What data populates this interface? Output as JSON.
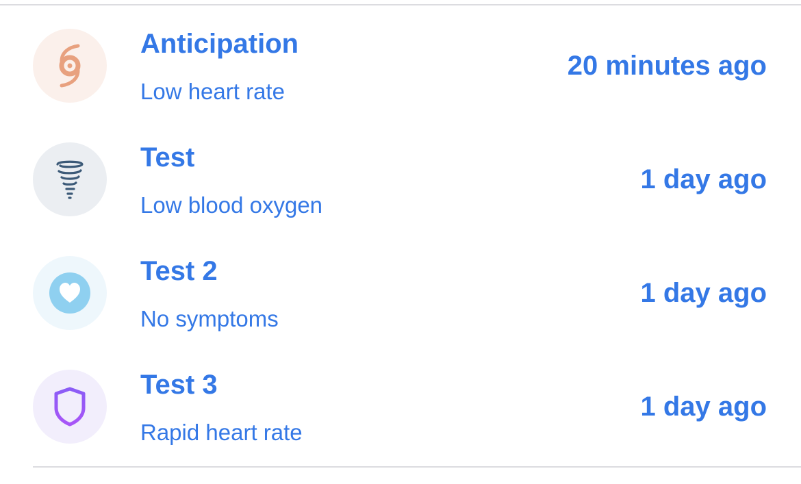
{
  "colors": {
    "accent": "#3478e6",
    "divider": "#dcdce0"
  },
  "entries": [
    {
      "title": "Anticipation",
      "subtitle": "Low heart rate",
      "time": "20 minutes ago",
      "icon": "hurricane-icon",
      "icon_color": "#e8a17f",
      "icon_bg": "#fbf0eb"
    },
    {
      "title": "Test",
      "subtitle": "Low blood oxygen",
      "time": "1 day ago",
      "icon": "tornado-icon",
      "icon_color": "#3c5a78",
      "icon_bg": "#ebeef2"
    },
    {
      "title": "Test 2",
      "subtitle": "No symptoms",
      "time": "1 day ago",
      "icon": "heart-icon",
      "icon_color": "#8fd0f0",
      "icon_bg": "#eef7fc"
    },
    {
      "title": "Test 3",
      "subtitle": "Rapid heart rate",
      "time": "1 day ago",
      "icon": "shield-icon",
      "icon_color": "#8b5cf6",
      "icon_bg": "#f2eefc"
    }
  ]
}
